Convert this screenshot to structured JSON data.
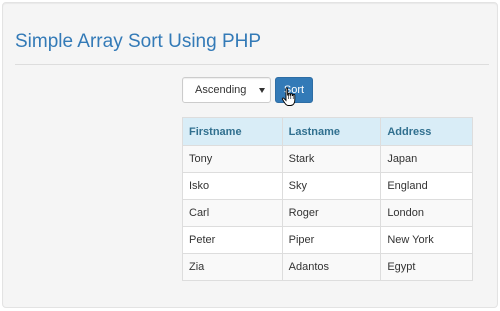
{
  "header": {
    "title": "Simple Array Sort Using PHP"
  },
  "form": {
    "order_select": {
      "selected": "Ascending"
    },
    "sort_label": "Sort"
  },
  "table": {
    "columns": [
      "Firstname",
      "Lastname",
      "Address"
    ],
    "rows": [
      [
        "Tony",
        "Stark",
        "Japan"
      ],
      [
        "Isko",
        "Sky",
        "England"
      ],
      [
        "Carl",
        "Roger",
        "London"
      ],
      [
        "Peter",
        "Piper",
        "New York"
      ],
      [
        "Zia",
        "Adantos",
        "Egypt"
      ]
    ]
  },
  "colors": {
    "accent": "#337ab7",
    "table_header_bg": "#d9edf7",
    "table_header_text": "#31708f"
  },
  "icons": {
    "cursor": "hand-pointer-icon",
    "select_caret": "caret-down-icon"
  }
}
